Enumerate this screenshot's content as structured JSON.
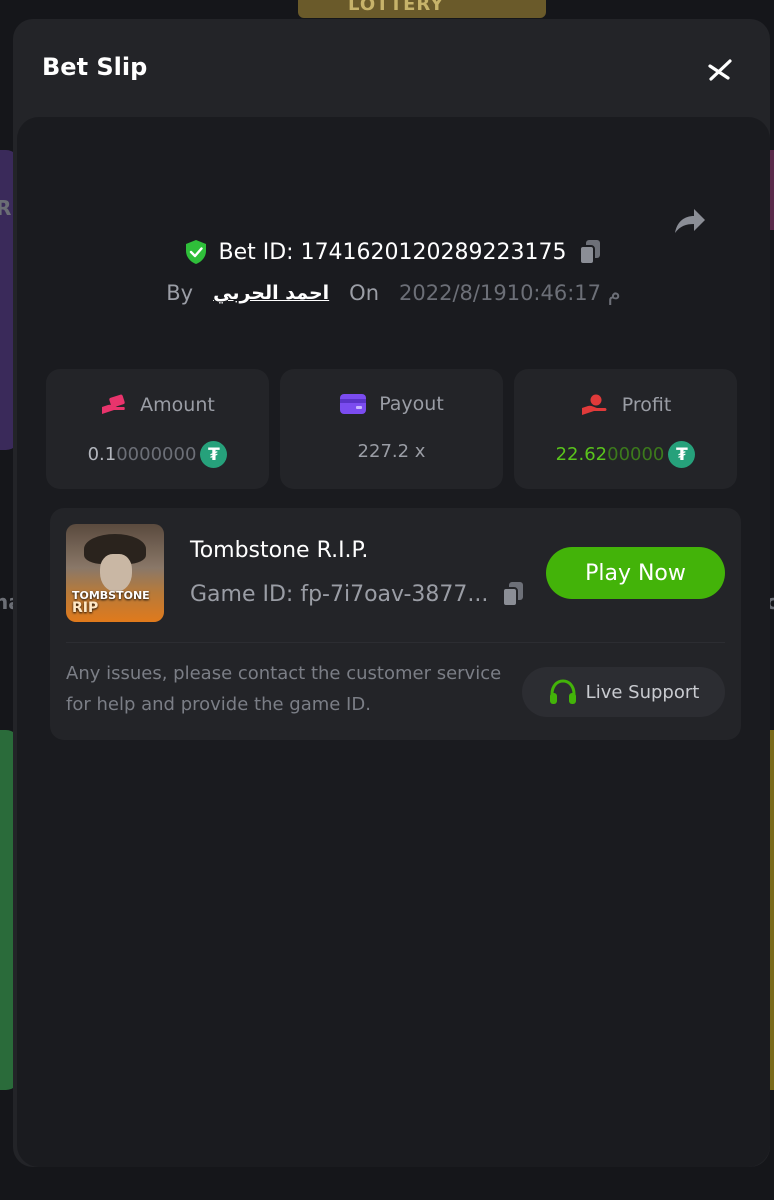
{
  "background": {
    "lottery_label": "LOTTERY",
    "left_edge_text": "Ri",
    "left_edge_text2": "ha",
    "right_edge_text": "c"
  },
  "modal": {
    "title": "Bet Slip"
  },
  "bet": {
    "id_text": "Bet ID: 1741620120289223175",
    "by_label": "By",
    "user": "احمد الحربي",
    "on_label": "On",
    "date": "2022/8/19م 10:46:17"
  },
  "stats": {
    "amount": {
      "label": "Amount",
      "value_strong": "0.1",
      "value_dim": "0000000"
    },
    "payout": {
      "label": "Payout",
      "value": "227.2 x"
    },
    "profit": {
      "label": "Profit",
      "value_strong": "22.62",
      "value_dim": "00000"
    }
  },
  "game": {
    "thumb_logo_line1": "TOMBSTONE",
    "thumb_logo_line2": "RIP",
    "title": "Tombstone R.I.P.",
    "id_text": "Game ID: fp-7i7oav-3877...",
    "play_label": "Play Now"
  },
  "support": {
    "help_text": "Any issues, please contact the customer service for help and provide the game ID.",
    "button_label": "Live Support"
  },
  "colors": {
    "accent_green": "#43b309",
    "profit_green": "#5ac41c",
    "usdt": "#26a17b",
    "shield_green": "#2fbf3a",
    "amount_icon": "#e8346c",
    "payout_icon": "#7b4cf0",
    "profit_icon": "#e03a3a"
  },
  "icons": {
    "close": "close-icon",
    "share": "share-icon",
    "shield": "shield-check-icon",
    "copy": "copy-icon",
    "amount": "money-hand-icon",
    "payout": "wallet-card-icon",
    "profit": "profit-hand-icon",
    "coin": "usdt-coin-icon",
    "headset": "headset-icon"
  }
}
